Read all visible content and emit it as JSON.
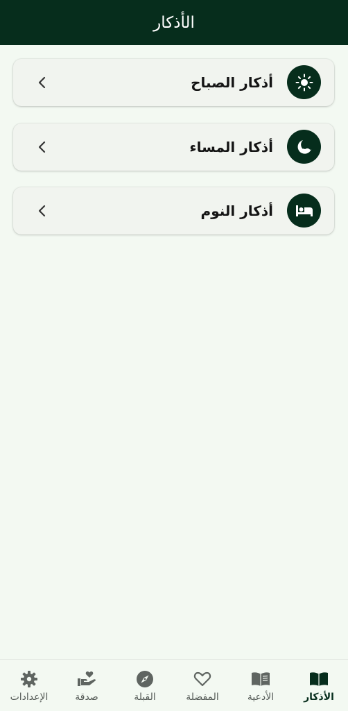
{
  "header": {
    "title": "الأذكار"
  },
  "colors": {
    "primary": "#062d1c",
    "background": "#f3f9f2",
    "card": "#f1f4ef",
    "inactive": "#555b57"
  },
  "cards": [
    {
      "label": "أذكار الصباح",
      "icon": "sun-icon"
    },
    {
      "label": "أذكار المساء",
      "icon": "moon-icon"
    },
    {
      "label": "أذكار النوم",
      "icon": "bed-icon"
    }
  ],
  "nav": {
    "items": [
      {
        "label": "الأذكار",
        "icon": "open-book-icon",
        "active": true
      },
      {
        "label": "الأدعية",
        "icon": "book-icon",
        "active": false
      },
      {
        "label": "المفضلة",
        "icon": "heart-icon",
        "active": false
      },
      {
        "label": "القبلة",
        "icon": "compass-icon",
        "active": false
      },
      {
        "label": "صدقة",
        "icon": "charity-hand-icon",
        "active": false
      },
      {
        "label": "الإعدادات",
        "icon": "gear-icon",
        "active": false
      }
    ]
  }
}
